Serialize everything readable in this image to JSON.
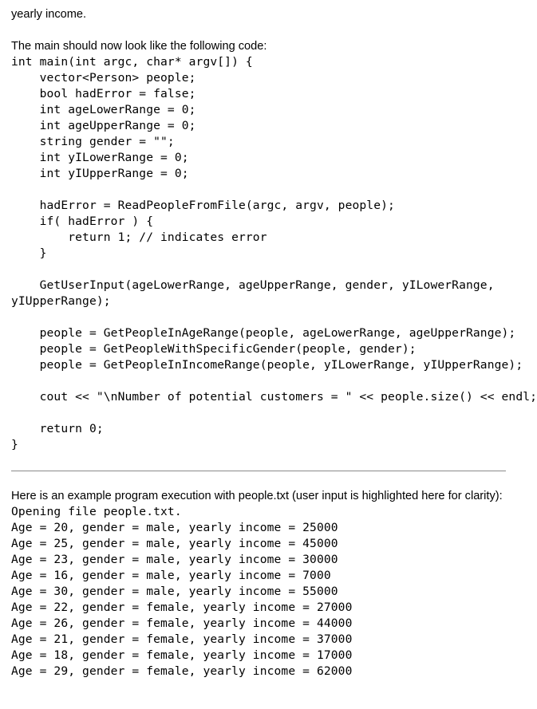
{
  "document": {
    "intro_fragment": "yearly income.",
    "code_intro": "The main should now look like the following code:",
    "main_code_lines": [
      "int main(int argc, char* argv[]) {",
      "    vector<Person> people;",
      "    bool hadError = false;",
      "    int ageLowerRange = 0;",
      "    int ageUpperRange = 0;",
      "    string gender = \"\";",
      "    int yILowerRange = 0;",
      "    int yIUpperRange = 0;",
      "",
      "    hadError = ReadPeopleFromFile(argc, argv, people);",
      "    if( hadError ) {",
      "        return 1; // indicates error",
      "    }",
      "",
      "    GetUserInput(ageLowerRange, ageUpperRange, gender, yILowerRange,",
      "yIUpperRange);",
      "",
      "    people = GetPeopleInAgeRange(people, ageLowerRange, ageUpperRange);",
      "    people = GetPeopleWithSpecificGender(people, gender);",
      "    people = GetPeopleInIncomeRange(people, yILowerRange, yIUpperRange);",
      "",
      "    cout << \"\\nNumber of potential customers = \" << people.size() << endl;",
      "",
      "    return 0;",
      "}"
    ],
    "execution_intro": "Here is an example program execution with people.txt (user input is highlighted here for clarity):",
    "execution_output_lines": [
      "Opening file people.txt.",
      "Age = 20, gender = male, yearly income = 25000",
      "Age = 25, gender = male, yearly income = 45000",
      "Age = 23, gender = male, yearly income = 30000",
      "Age = 16, gender = male, yearly income = 7000",
      "Age = 30, gender = male, yearly income = 55000",
      "Age = 22, gender = female, yearly income = 27000",
      "Age = 26, gender = female, yearly income = 44000",
      "Age = 21, gender = female, yearly income = 37000",
      "Age = 18, gender = female, yearly income = 17000",
      "Age = 29, gender = female, yearly income = 62000"
    ]
  },
  "colors": {
    "text": "#000000",
    "background": "#ffffff",
    "divider": "#8a8a8a"
  }
}
